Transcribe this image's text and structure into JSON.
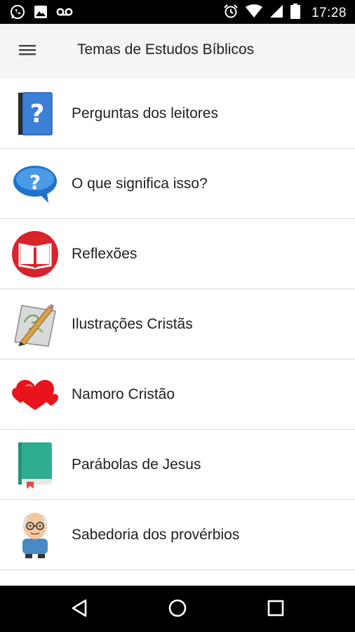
{
  "status_bar": {
    "time": "17:28",
    "left_icons": [
      "whatsapp-icon",
      "image-icon",
      "voicemail-icon"
    ],
    "right_icons": [
      "alarm-icon",
      "wifi-icon",
      "signal-icon",
      "battery-icon"
    ]
  },
  "app_bar": {
    "title": "Temas de Estudos Bíblicos",
    "menu_icon": "hamburger-menu-icon",
    "background": "#f5f5f5"
  },
  "list": {
    "items": [
      {
        "label": "Perguntas dos leitores",
        "icon": "question-book-icon"
      },
      {
        "label": "O que significa isso?",
        "icon": "question-bubble-icon"
      },
      {
        "label": "Reflexões",
        "icon": "open-book-icon"
      },
      {
        "label": "Ilustrações Cristãs",
        "icon": "pencil-drawing-icon"
      },
      {
        "label": "Namoro Cristão",
        "icon": "hearts-icon"
      },
      {
        "label": "Parábolas de Jesus",
        "icon": "green-book-icon"
      },
      {
        "label": "Sabedoria dos provérbios",
        "icon": "old-man-icon"
      }
    ]
  },
  "nav_bar": {
    "buttons": [
      "back-icon",
      "home-icon",
      "recents-icon"
    ]
  },
  "colors": {
    "status_bar": "#000000",
    "nav_bar": "#000000",
    "divider": "#d9d9d9",
    "text": "#212121",
    "reflexoes_red": "#d8232a",
    "bubble_blue": "#1e73c8",
    "book_green": "#2fae8f",
    "hearts_red": "#e8131b"
  }
}
